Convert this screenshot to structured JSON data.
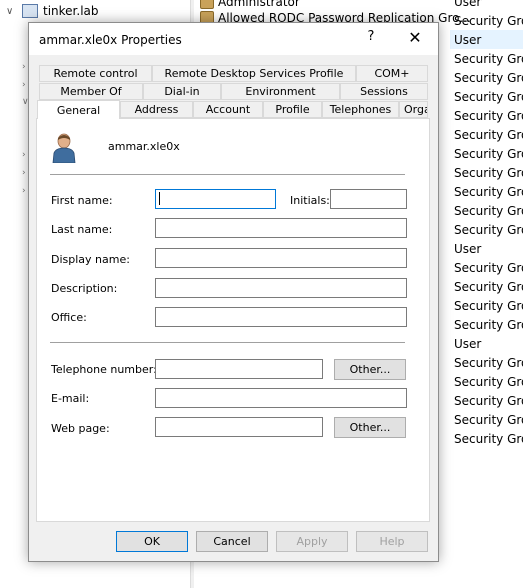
{
  "background": {
    "tree": {
      "domain": "tinker.lab"
    },
    "list_names": [
      "Administrator",
      "Allowed RODC Password Replication Gro..."
    ],
    "type_column": [
      "User",
      "Security Grou",
      "User",
      "Security Grou",
      "Security Grou",
      "Security Grou",
      "Security Grou",
      "Security Grou",
      "Security Grou",
      "Security Grou",
      "Security Grou",
      "Security Grou",
      "Security Grou",
      "User",
      "Security Grou",
      "Security Grou",
      "Security Grou",
      "Security Grou",
      "User",
      "Security Grou",
      "Security Grou",
      "Security Grou",
      "Security Grou",
      "Security Grou"
    ],
    "selected_type_index": 2
  },
  "dialog": {
    "title": "ammar.xle0x Properties",
    "help_glyph": "?",
    "close_glyph": "✕",
    "tabs_row1": [
      "Remote control",
      "Remote Desktop Services Profile",
      "COM+"
    ],
    "tabs_row2": [
      "Member Of",
      "Dial-in",
      "Environment",
      "Sessions"
    ],
    "tabs_row3": [
      "General",
      "Address",
      "Account",
      "Profile",
      "Telephones",
      "Organization"
    ],
    "active_tab": "General",
    "username": "ammar.xle0x",
    "labels": {
      "first_name": "First name:",
      "initials": "Initials:",
      "last_name": "Last name:",
      "display_name": "Display name:",
      "description": "Description:",
      "office": "Office:",
      "telephone": "Telephone number:",
      "email": "E-mail:",
      "web_page": "Web page:"
    },
    "values": {
      "first_name": "",
      "initials": "",
      "last_name": "",
      "display_name": "",
      "description": "",
      "office": "",
      "telephone": "",
      "email": "",
      "web_page": ""
    },
    "other_button": "Other...",
    "buttons": {
      "ok": "OK",
      "cancel": "Cancel",
      "apply": "Apply",
      "help": "Help"
    }
  }
}
